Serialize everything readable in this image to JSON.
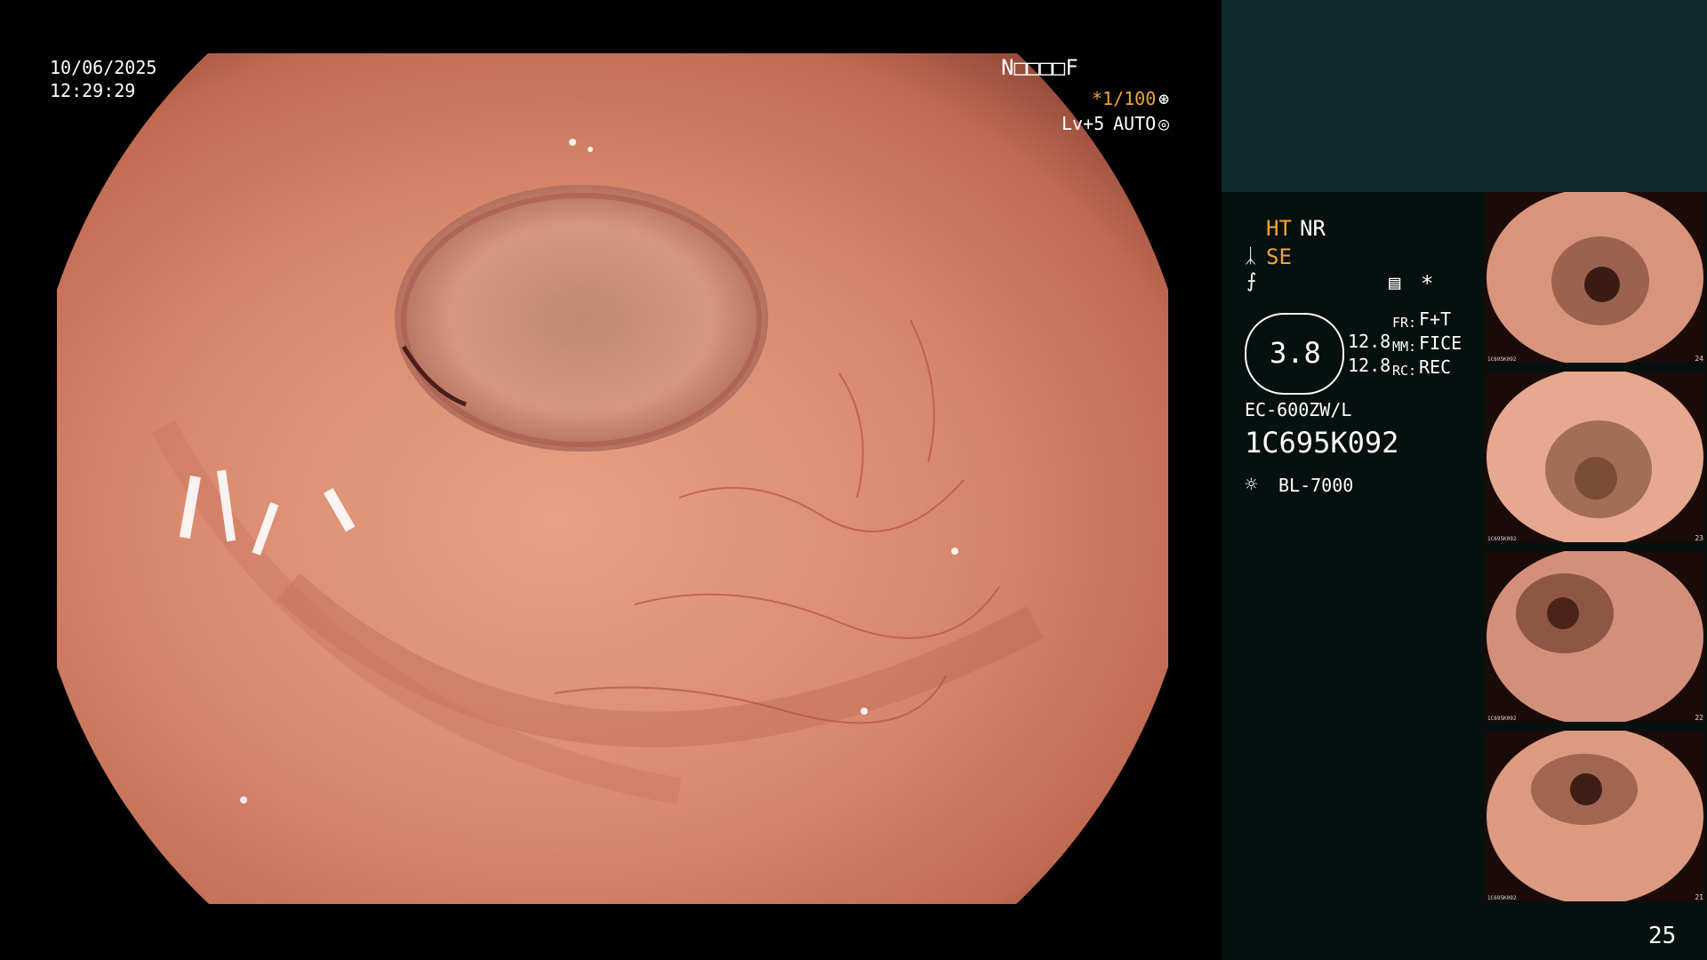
{
  "osd": {
    "date": "10/06/2025",
    "time": "12:29:29",
    "id_label": "N□□□□F",
    "shutter": "*1/100",
    "level": "Lv+5",
    "mode": "AUTO"
  },
  "settings": {
    "ht": "HT",
    "nr": "NR",
    "se": "SE",
    "gauge_value": "3.8",
    "val1": "12.8",
    "val2": "12.8",
    "fr_label": "FR:",
    "fr_value": "F+T",
    "mm_label": "MM:",
    "mm_value": "FICE",
    "rc_label": "RC:",
    "rc_value": "REC",
    "star": "*"
  },
  "scope_model": "EC-600ZW/L",
  "serial": "1C695K092",
  "light_source": "BL-7000",
  "thumbnails": [
    {
      "number": "24",
      "id": "1C695K092"
    },
    {
      "number": "23",
      "id": "1C695K092"
    },
    {
      "number": "22",
      "id": "1C695K092"
    },
    {
      "number": "21",
      "id": "1C695K092"
    }
  ],
  "image_count": "25",
  "colors": {
    "tissue": "#d98a6e",
    "panel_bg": "#06100f",
    "panel_top": "#0f2a2a",
    "accent": "#f2a531"
  }
}
